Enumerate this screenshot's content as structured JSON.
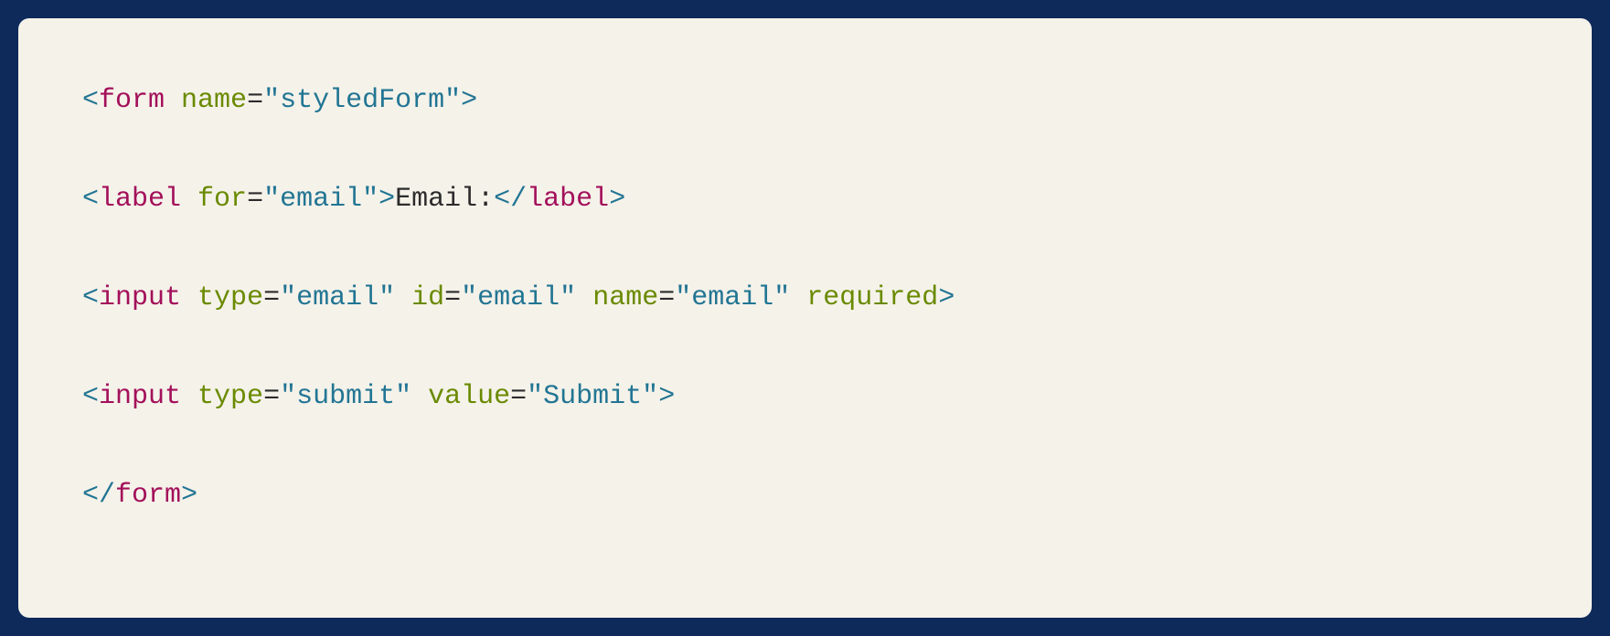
{
  "code": {
    "lines": [
      {
        "tokens": [
          {
            "t": "pun",
            "v": "<"
          },
          {
            "t": "tag",
            "v": "form"
          },
          {
            "t": "txt",
            "v": " "
          },
          {
            "t": "attr",
            "v": "name"
          },
          {
            "t": "eq",
            "v": "="
          },
          {
            "t": "str",
            "v": "\"styledForm\""
          },
          {
            "t": "pun",
            "v": ">"
          }
        ]
      },
      {
        "tokens": [
          {
            "t": "pun",
            "v": "<"
          },
          {
            "t": "tag",
            "v": "label"
          },
          {
            "t": "txt",
            "v": " "
          },
          {
            "t": "attr",
            "v": "for"
          },
          {
            "t": "eq",
            "v": "="
          },
          {
            "t": "str",
            "v": "\"email\""
          },
          {
            "t": "pun",
            "v": ">"
          },
          {
            "t": "txt",
            "v": "Email:"
          },
          {
            "t": "pun",
            "v": "</"
          },
          {
            "t": "tag",
            "v": "label"
          },
          {
            "t": "pun",
            "v": ">"
          }
        ]
      },
      {
        "tokens": [
          {
            "t": "pun",
            "v": "<"
          },
          {
            "t": "tag",
            "v": "input"
          },
          {
            "t": "txt",
            "v": " "
          },
          {
            "t": "attr",
            "v": "type"
          },
          {
            "t": "eq",
            "v": "="
          },
          {
            "t": "str",
            "v": "\"email\""
          },
          {
            "t": "txt",
            "v": " "
          },
          {
            "t": "attr",
            "v": "id"
          },
          {
            "t": "eq",
            "v": "="
          },
          {
            "t": "str",
            "v": "\"email\""
          },
          {
            "t": "txt",
            "v": " "
          },
          {
            "t": "attr",
            "v": "name"
          },
          {
            "t": "eq",
            "v": "="
          },
          {
            "t": "str",
            "v": "\"email\""
          },
          {
            "t": "txt",
            "v": " "
          },
          {
            "t": "attr",
            "v": "required"
          },
          {
            "t": "pun",
            "v": ">"
          }
        ]
      },
      {
        "tokens": [
          {
            "t": "pun",
            "v": "<"
          },
          {
            "t": "tag",
            "v": "input"
          },
          {
            "t": "txt",
            "v": " "
          },
          {
            "t": "attr",
            "v": "type"
          },
          {
            "t": "eq",
            "v": "="
          },
          {
            "t": "str",
            "v": "\"submit\""
          },
          {
            "t": "txt",
            "v": " "
          },
          {
            "t": "attr",
            "v": "value"
          },
          {
            "t": "eq",
            "v": "="
          },
          {
            "t": "str",
            "v": "\"Submit\""
          },
          {
            "t": "pun",
            "v": ">"
          }
        ]
      },
      {
        "tokens": [
          {
            "t": "pun",
            "v": "</"
          },
          {
            "t": "tag",
            "v": "form"
          },
          {
            "t": "pun",
            "v": ">"
          }
        ]
      }
    ]
  }
}
